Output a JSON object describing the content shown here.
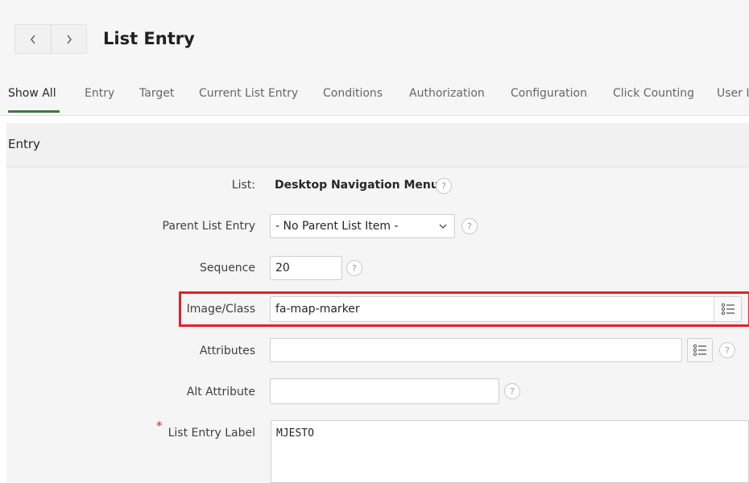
{
  "header": {
    "title": "List Entry",
    "prev_icon": "chevron-left-icon",
    "next_icon": "chevron-right-icon"
  },
  "tabs": [
    {
      "label": "Show All",
      "active": true
    },
    {
      "label": "Entry",
      "active": false
    },
    {
      "label": "Target",
      "active": false
    },
    {
      "label": "Current List Entry",
      "active": false
    },
    {
      "label": "Conditions",
      "active": false
    },
    {
      "label": "Authorization",
      "active": false
    },
    {
      "label": "Configuration",
      "active": false
    },
    {
      "label": "Click Counting",
      "active": false
    },
    {
      "label": "User I",
      "active": false
    }
  ],
  "section": {
    "title": "Entry"
  },
  "form": {
    "list": {
      "label": "List:",
      "value": "Desktop Navigation Menu"
    },
    "parent": {
      "label": "Parent List Entry",
      "value": "- No Parent List Item -"
    },
    "sequence": {
      "label": "Sequence",
      "value": "20"
    },
    "image_class": {
      "label": "Image/Class",
      "value": "fa-map-marker"
    },
    "attributes": {
      "label": "Attributes",
      "value": ""
    },
    "alt_attribute": {
      "label": "Alt Attribute",
      "value": ""
    },
    "entry_label": {
      "label": "List Entry Label",
      "value": "MJESTO",
      "required_marker": "*"
    }
  },
  "colors": {
    "accent_underline": "#3d7a3a",
    "highlight_border": "#e3202e",
    "required": "#d0271c"
  },
  "help_glyph": "?"
}
